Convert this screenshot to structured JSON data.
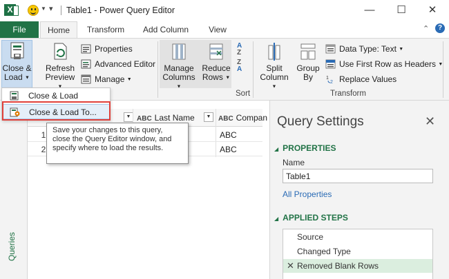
{
  "titlebar": {
    "app_logo": "X",
    "title": "Table1 - Power Query Editor",
    "minimize": "—",
    "maximize": "☐",
    "close": "✕"
  },
  "tabs": {
    "file": "File",
    "items": [
      "Home",
      "Transform",
      "Add Column",
      "View"
    ],
    "active": "Home",
    "collapse": "⌃",
    "help": "?"
  },
  "ribbon": {
    "close_load": [
      "Close &",
      "Load"
    ],
    "refresh_preview": [
      "Refresh",
      "Preview"
    ],
    "properties": "Properties",
    "advanced_editor": "Advanced Editor",
    "manage": "Manage",
    "manage_columns": [
      "Manage",
      "Columns"
    ],
    "reduce_rows": [
      "Reduce",
      "Rows"
    ],
    "sort_label": "Sort",
    "split_column": [
      "Split",
      "Column"
    ],
    "group_by": [
      "Group",
      "By"
    ],
    "data_type": "Data Type: Text",
    "use_first_row": "Use First Row as Headers",
    "replace_values": "Replace Values",
    "transform_label": "Transform"
  },
  "menu": {
    "items": [
      "Close & Load",
      "Close & Load To..."
    ]
  },
  "tooltip": {
    "text": "Save your changes to this query, close the Query Editor window, and specify where to load the results."
  },
  "grid": {
    "columns": [
      "Last Name",
      "Compan"
    ],
    "col_type": "ABC",
    "rows": [
      {
        "num": "1",
        "company": "ABC"
      },
      {
        "num": "2",
        "company": "ABC"
      }
    ]
  },
  "leftnav": {
    "label": "Queries"
  },
  "query_settings": {
    "title": "Query Settings",
    "close": "✕",
    "properties_header": "PROPERTIES",
    "name_label": "Name",
    "name_value": "Table1",
    "all_properties": "All Properties",
    "applied_steps_header": "APPLIED STEPS",
    "steps": [
      "Source",
      "Changed Type",
      "Removed Blank Rows"
    ]
  }
}
